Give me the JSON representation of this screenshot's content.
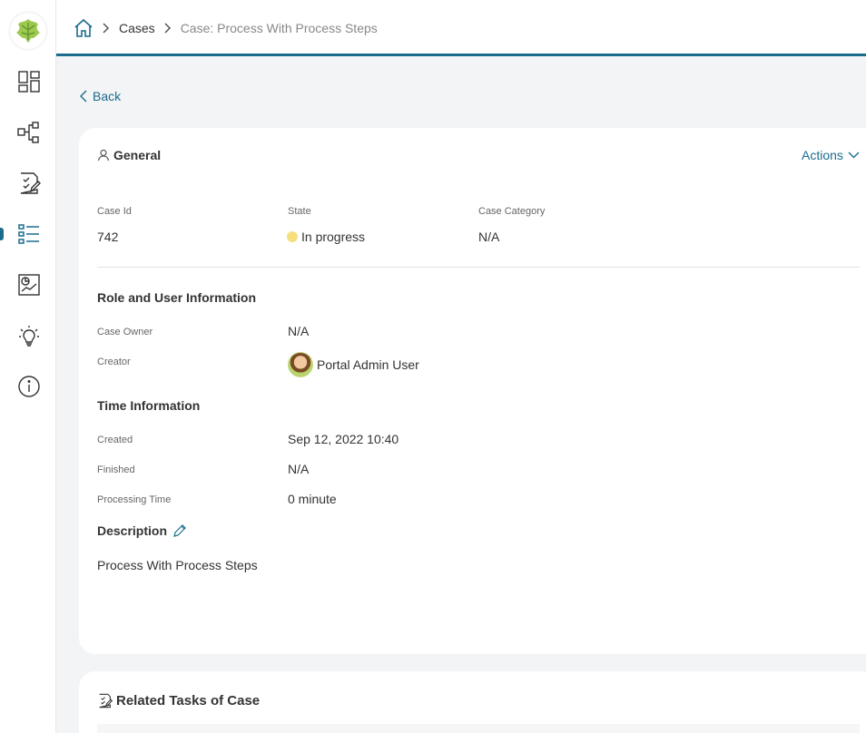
{
  "breadcrumb": {
    "items": [
      "Cases",
      "Case: Process With Process Steps"
    ]
  },
  "back_label": "Back",
  "general": {
    "title": "General",
    "actions_label": "Actions",
    "case_id_label": "Case Id",
    "case_id": "742",
    "state_label": "State",
    "state": "In progress",
    "category_label": "Case Category",
    "category": "N/A"
  },
  "roles": {
    "title": "Role and User Information",
    "owner_label": "Case Owner",
    "owner": "N/A",
    "creator_label": "Creator",
    "creator": "Portal Admin User"
  },
  "time": {
    "title": "Time Information",
    "created_label": "Created",
    "created": "Sep 12, 2022 10:40",
    "finished_label": "Finished",
    "finished": "N/A",
    "processing_label": "Processing Time",
    "processing": "0 minute"
  },
  "description": {
    "title": "Description",
    "text": "Process With Process Steps"
  },
  "related": {
    "title": "Related Tasks of Case"
  },
  "colors": {
    "accent": "#1b6c8d",
    "state_in_progress": "#f7df7e"
  },
  "sidebar_icons": [
    "logo-icon",
    "dashboard-icon",
    "processes-icon",
    "tasks-icon",
    "cases-icon",
    "statistics-icon",
    "ideas-icon",
    "info-icon"
  ]
}
